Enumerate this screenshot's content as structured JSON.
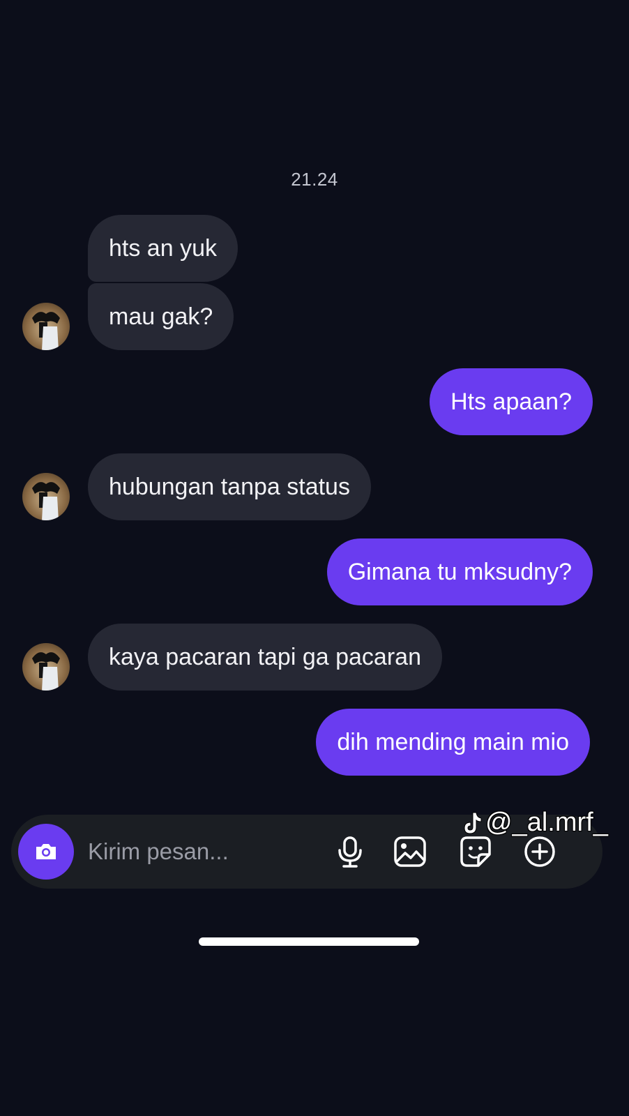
{
  "conversation": {
    "timestamp": "21.24",
    "messages": [
      {
        "id": "m1",
        "direction": "incoming",
        "text": "hts an yuk"
      },
      {
        "id": "m2",
        "direction": "incoming",
        "text": "mau gak?"
      },
      {
        "id": "m3",
        "direction": "outgoing",
        "text": "Hts apaan?"
      },
      {
        "id": "m4",
        "direction": "incoming",
        "text": "hubungan tanpa status"
      },
      {
        "id": "m5",
        "direction": "outgoing",
        "text": "Gimana tu mksudny?"
      },
      {
        "id": "m6",
        "direction": "incoming",
        "text": "kaya pacaran tapi ga pacaran"
      },
      {
        "id": "m7",
        "direction": "outgoing",
        "text": "dih mending main mio"
      }
    ]
  },
  "composer": {
    "placeholder": "Kirim pesan...",
    "value": "",
    "icons": [
      "camera-icon",
      "microphone-icon",
      "image-icon",
      "sticker-icon",
      "plus-circle-icon"
    ]
  },
  "watermark": {
    "logo_icon": "tiktok-icon",
    "handle": "@_al.mrf_"
  },
  "colors": {
    "background": "#0c0e1a",
    "incoming_bubble": "#262834",
    "outgoing_bubble": "#6a3cf0",
    "composer_bg": "#1b1e23",
    "camera_button": "#6a3cf0"
  }
}
